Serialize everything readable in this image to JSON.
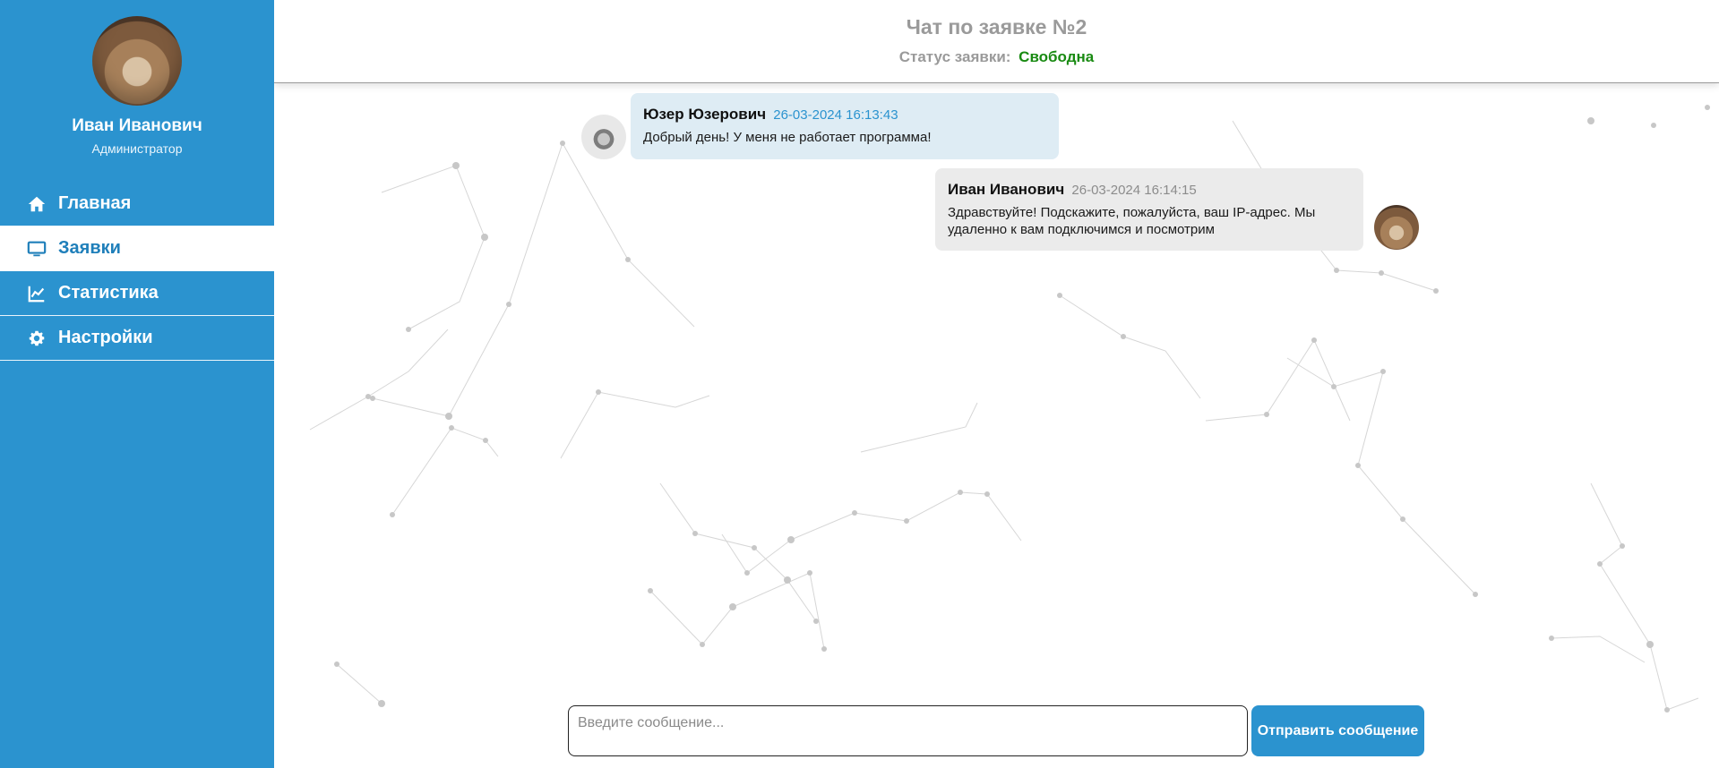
{
  "profile": {
    "name": "Иван Иванович",
    "role": "Администратор"
  },
  "nav": {
    "items": [
      {
        "label": "Главная",
        "icon": "home-icon",
        "active": false
      },
      {
        "label": "Заявки",
        "icon": "monitor-icon",
        "active": true
      },
      {
        "label": "Статистика",
        "icon": "chart-icon",
        "active": false
      },
      {
        "label": "Настройки",
        "icon": "gear-icon",
        "active": false
      }
    ]
  },
  "header": {
    "title": "Чат по заявке №2",
    "status_label": "Статус заявки:",
    "status_value": "Свободна"
  },
  "messages": [
    {
      "author": "Юзер Юзерович",
      "time": "26-03-2024 16:13:43",
      "text": "Добрый день! У меня не работает программа!",
      "direction": "incoming",
      "avatar": "cat-avatar"
    },
    {
      "author": "Иван Иванович",
      "time": "26-03-2024 16:14:15",
      "text": "Здравствуйте! Подскажите, пожалуйста, ваш IP-адрес. Мы удаленно к вам подключимся и посмотрим",
      "direction": "outgoing",
      "avatar": "cat-avatar"
    }
  ],
  "composer": {
    "placeholder": "Введите сообщение...",
    "value": "",
    "send_label": "Отправить сообщение"
  },
  "colors": {
    "sidebar": "#2b93cf",
    "active_text": "#1f7fba",
    "status_free": "#198a12",
    "incoming_bubble": "#deecf4",
    "outgoing_bubble": "#ebebeb"
  }
}
